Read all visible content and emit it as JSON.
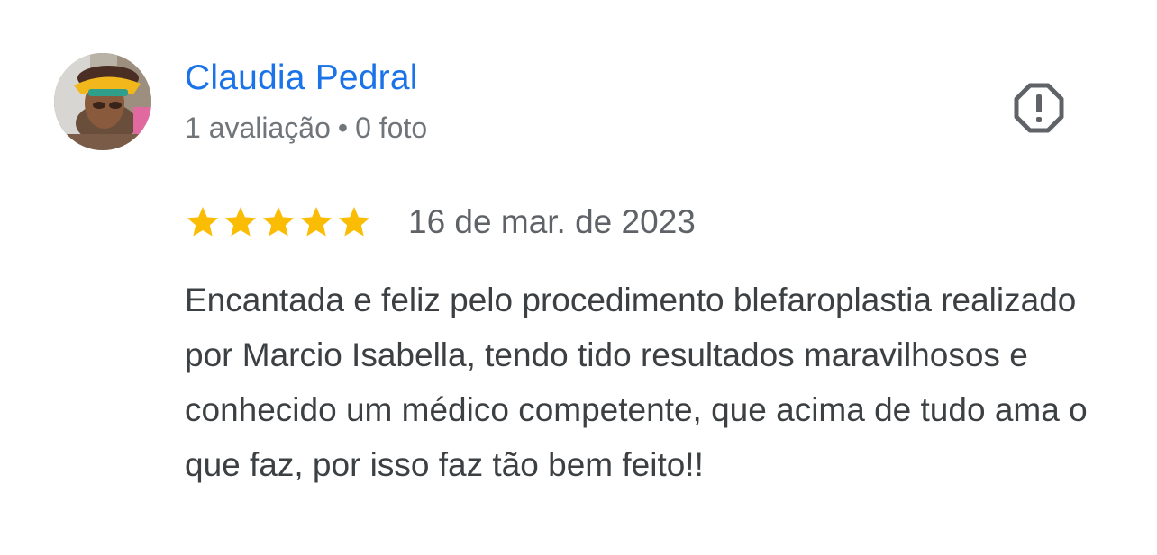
{
  "review": {
    "author": {
      "name": "Claudia Pedral",
      "reviews_count": "1 avaliação",
      "separator": "•",
      "photos_count": "0 foto"
    },
    "rating": {
      "stars": 5,
      "max_stars": 5,
      "date": "16 de mar. de 2023"
    },
    "text": "Encantada e feliz pelo procedimento blefaroplastia realizado por Marcio Isabella, tendo tido resultados maravilhosos e conhecido um médico competente, que acima de tudo ama o que faz, por isso faz tão bem feito!!",
    "icons": {
      "report": "report-flag-octagon-icon",
      "star": "star-icon",
      "avatar": "avatar-photo"
    },
    "colors": {
      "author_name": "#1a73e8",
      "meta_text": "#70757a",
      "star_fill": "#fbbc04",
      "body_text": "#3c4043",
      "report_icon": "#5f6368"
    }
  }
}
